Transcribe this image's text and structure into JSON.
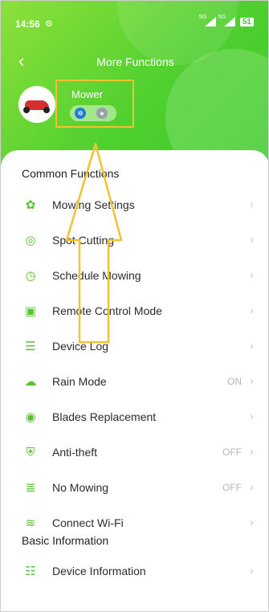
{
  "status_bar": {
    "time": "14:56",
    "gear_icon": "⚙",
    "signal_1": "5G",
    "signal_2": "5G",
    "battery": "51"
  },
  "header": {
    "back_glyph": "‹",
    "title": "More Functions"
  },
  "device": {
    "name": "Mower",
    "bluetooth_glyph": "✲",
    "wifi_glyph": "●"
  },
  "sections": {
    "common": "Common Functions",
    "basic": "Basic Information"
  },
  "menu": [
    {
      "label": "Mowing Settings",
      "value": "",
      "icon": "flower-gear-icon",
      "glyph": "✿"
    },
    {
      "label": "Spot Cutting",
      "value": "",
      "icon": "target-icon",
      "glyph": "◎"
    },
    {
      "label": "Schedule Mowing",
      "value": "",
      "icon": "clock-icon",
      "glyph": "◷"
    },
    {
      "label": "Remote Control Mode",
      "value": "",
      "icon": "remote-icon",
      "glyph": "▣"
    },
    {
      "label": "Device Log",
      "value": "",
      "icon": "document-icon",
      "glyph": "☰"
    },
    {
      "label": "Rain Mode",
      "value": "ON",
      "icon": "rain-cloud-icon",
      "glyph": "☁"
    },
    {
      "label": "Blades Replacement",
      "value": "",
      "icon": "blade-icon",
      "glyph": "◉"
    },
    {
      "label": "Anti-theft",
      "value": "OFF",
      "icon": "shield-icon",
      "glyph": "⛨"
    },
    {
      "label": "No Mowing",
      "value": "OFF",
      "icon": "no-mowing-icon",
      "glyph": "≣"
    },
    {
      "label": "Connect Wi-Fi",
      "value": "",
      "icon": "wifi-icon",
      "glyph": "≋"
    }
  ],
  "basic_menu": [
    {
      "label": "Device Information",
      "value": "",
      "icon": "info-card-icon",
      "glyph": "☷"
    }
  ],
  "chevron": "›",
  "colors": {
    "accent": "#4fd02f",
    "annotation": "#f2c230"
  }
}
